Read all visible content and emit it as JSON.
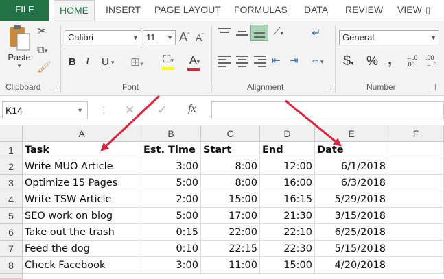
{
  "ribbon_tabs": [
    "FILE",
    "HOME",
    "INSERT",
    "PAGE LAYOUT",
    "FORMULAS",
    "DATA",
    "REVIEW",
    "VIEW"
  ],
  "active_tab": "HOME",
  "clipboard": {
    "paste_label": "Paste",
    "group_label": "Clipboard"
  },
  "font": {
    "name": "Calibri",
    "size": "11",
    "group_label": "Font",
    "bold": "B",
    "italic": "I",
    "underline": "U",
    "grow": "A",
    "shrink": "A",
    "font_color": "A"
  },
  "alignment": {
    "group_label": "Alignment"
  },
  "number": {
    "format": "General",
    "currency": "$",
    "percent": "%",
    "comma": ",",
    "group_label": "Number",
    "inc_decimal": "←.0 .00",
    "dec_decimal": ".00 →.0"
  },
  "formula_bar": {
    "name_box": "K14",
    "fx_label": "fx",
    "cancel": "✕",
    "enter": "✓",
    "formula": ""
  },
  "sheet": {
    "columns": [
      "A",
      "B",
      "C",
      "D",
      "E",
      "F"
    ],
    "rows": [
      {
        "num": "1",
        "cells": [
          "Task",
          "Est. Time",
          "Start",
          "End",
          "Date",
          ""
        ]
      },
      {
        "num": "2",
        "cells": [
          "Write MUO Article",
          "3:00",
          "8:00",
          "12:00",
          "6/1/2018",
          ""
        ]
      },
      {
        "num": "3",
        "cells": [
          "Optimize 15 Pages",
          "5:00",
          "8:00",
          "16:00",
          "6/3/2018",
          ""
        ]
      },
      {
        "num": "4",
        "cells": [
          "Write TSW Article",
          "2:00",
          "15:00",
          "16:15",
          "5/29/2018",
          ""
        ]
      },
      {
        "num": "5",
        "cells": [
          "SEO work on blog",
          "5:00",
          "17:00",
          "21:30",
          "3/15/2018",
          ""
        ]
      },
      {
        "num": "6",
        "cells": [
          "Take out the trash",
          "0:15",
          "22:00",
          "22:10",
          "6/25/2018",
          ""
        ]
      },
      {
        "num": "7",
        "cells": [
          "Feed the dog",
          "0:10",
          "22:15",
          "22:30",
          "5/15/2018",
          ""
        ]
      },
      {
        "num": "8",
        "cells": [
          "Check Facebook",
          "3:00",
          "11:00",
          "15:00",
          "4/20/2018",
          ""
        ]
      }
    ]
  },
  "colors": {
    "excel_green": "#217346",
    "annotation_arrow": "#e0203a",
    "font_color_bar": "#e0203a",
    "fill_color_bar": "#ffff00"
  }
}
